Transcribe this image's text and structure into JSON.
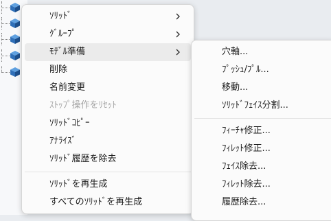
{
  "tree": {
    "icon": "solid-body-cube-icon"
  },
  "menu": {
    "items": [
      {
        "label": "ｿﾘｯﾄﾞ"
      },
      {
        "label": "ｸﾞﾙｰﾌﾟ"
      },
      {
        "label": "ﾓﾃﾞﾙ準備"
      },
      {
        "label": "削除"
      },
      {
        "label": "名前変更"
      },
      {
        "label": "ｽﾄｯﾌﾟ操作をﾘｾｯﾄ"
      },
      {
        "label": "ｿﾘｯﾄﾞｺﾋﾟｰ"
      },
      {
        "label": "ｱﾅﾗｲｽﾞ"
      },
      {
        "label": "ｿﾘｯﾄﾞ履歴を除去"
      },
      {
        "label": "ｿﾘｯﾄﾞを再生成"
      },
      {
        "label": "すべてのｿﾘｯﾄﾞを再生成"
      }
    ]
  },
  "submenu": {
    "items": [
      {
        "label": "穴軸..."
      },
      {
        "label": "ﾌﾟｯｼｭ/ﾌﾟﾙ..."
      },
      {
        "label": "移動..."
      },
      {
        "label": "ｿﾘｯﾄﾞﾌｪｲｽ分割..."
      },
      {
        "label": "ﾌｨｰﾁｬ修正..."
      },
      {
        "label": "ﾌｨﾚｯﾄ修正..."
      },
      {
        "label": "ﾌｪｲｽ除去..."
      },
      {
        "label": "ﾌｨﾚｯﾄ除去..."
      },
      {
        "label": "履歴除去..."
      }
    ]
  },
  "colors": {
    "cube_top": "#5fa0e0",
    "cube_left": "#2f6fb8",
    "cube_right": "#1d4f8c",
    "hover": "#ebebeb",
    "disabled_text": "#a3a3a3"
  }
}
